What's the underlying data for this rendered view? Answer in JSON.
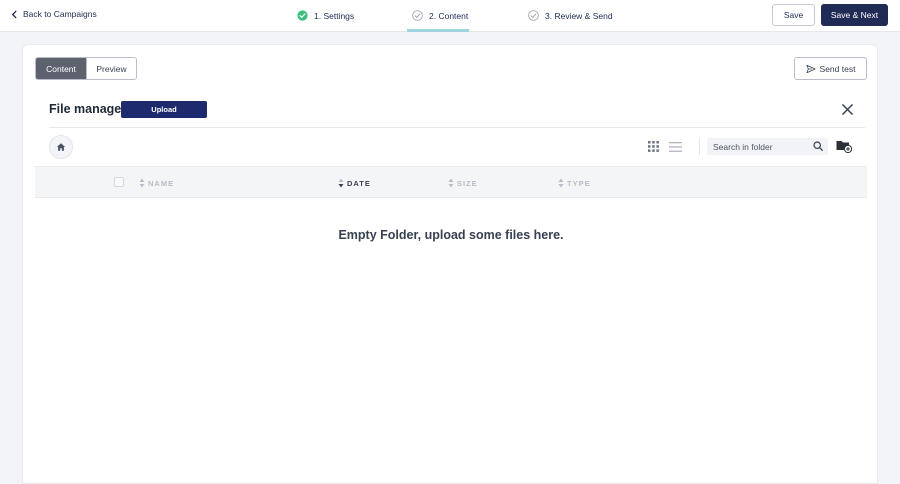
{
  "topbar": {
    "back_label": "Back to Campaigns",
    "steps": [
      {
        "label": "1. Settings",
        "state": "done"
      },
      {
        "label": "2. Content",
        "state": "active"
      },
      {
        "label": "3. Review & Send",
        "state": "pending"
      }
    ],
    "save_label": "Save",
    "save_next_label": "Save & Next"
  },
  "editor": {
    "tabs": [
      {
        "label": "Content",
        "active": true
      },
      {
        "label": "Preview",
        "active": false
      }
    ],
    "send_test_label": "Send test"
  },
  "file_manager": {
    "title": "File manager",
    "upload_label": "Upload",
    "search_placeholder": "Search in folder",
    "columns": [
      {
        "label": "NAME",
        "sorted": false
      },
      {
        "label": "DATE",
        "sorted": true
      },
      {
        "label": "SIZE",
        "sorted": false
      },
      {
        "label": "TYPE",
        "sorted": false
      }
    ],
    "empty_message": "Empty Folder, upload some files here."
  },
  "colors": {
    "brand_navy": "#1f2a55",
    "upload_blue": "#1e2a6e",
    "step_done_green": "#3fbf7f",
    "active_step_underline": "#9fd3de"
  },
  "icons": [
    "chevron-left-icon",
    "check-circle-icon",
    "paper-plane-icon",
    "close-icon",
    "home-icon",
    "grid-view-icon",
    "list-view-icon",
    "search-icon",
    "add-folder-icon",
    "sort-icon"
  ]
}
